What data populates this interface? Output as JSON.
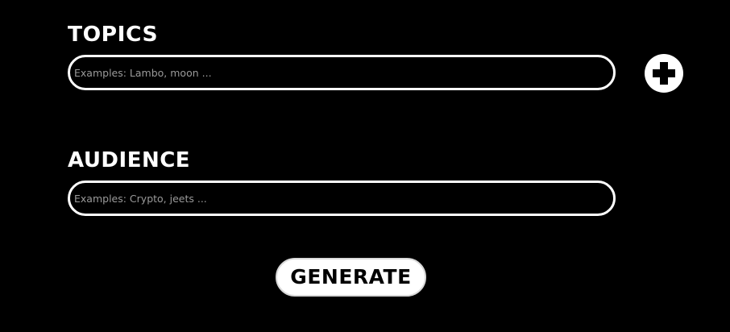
{
  "form": {
    "topics": {
      "label": "TOPICS",
      "placeholder": "Examples: Lambo, moon ...",
      "value": ""
    },
    "audience": {
      "label": "AUDIENCE",
      "placeholder": "Examples: Crypto, jeets ...",
      "value": ""
    },
    "add_button_icon": "plus-icon",
    "generate_label": "GENERATE"
  },
  "colors": {
    "background": "#000000",
    "foreground": "#ffffff",
    "placeholder": "#9a9a9a"
  }
}
